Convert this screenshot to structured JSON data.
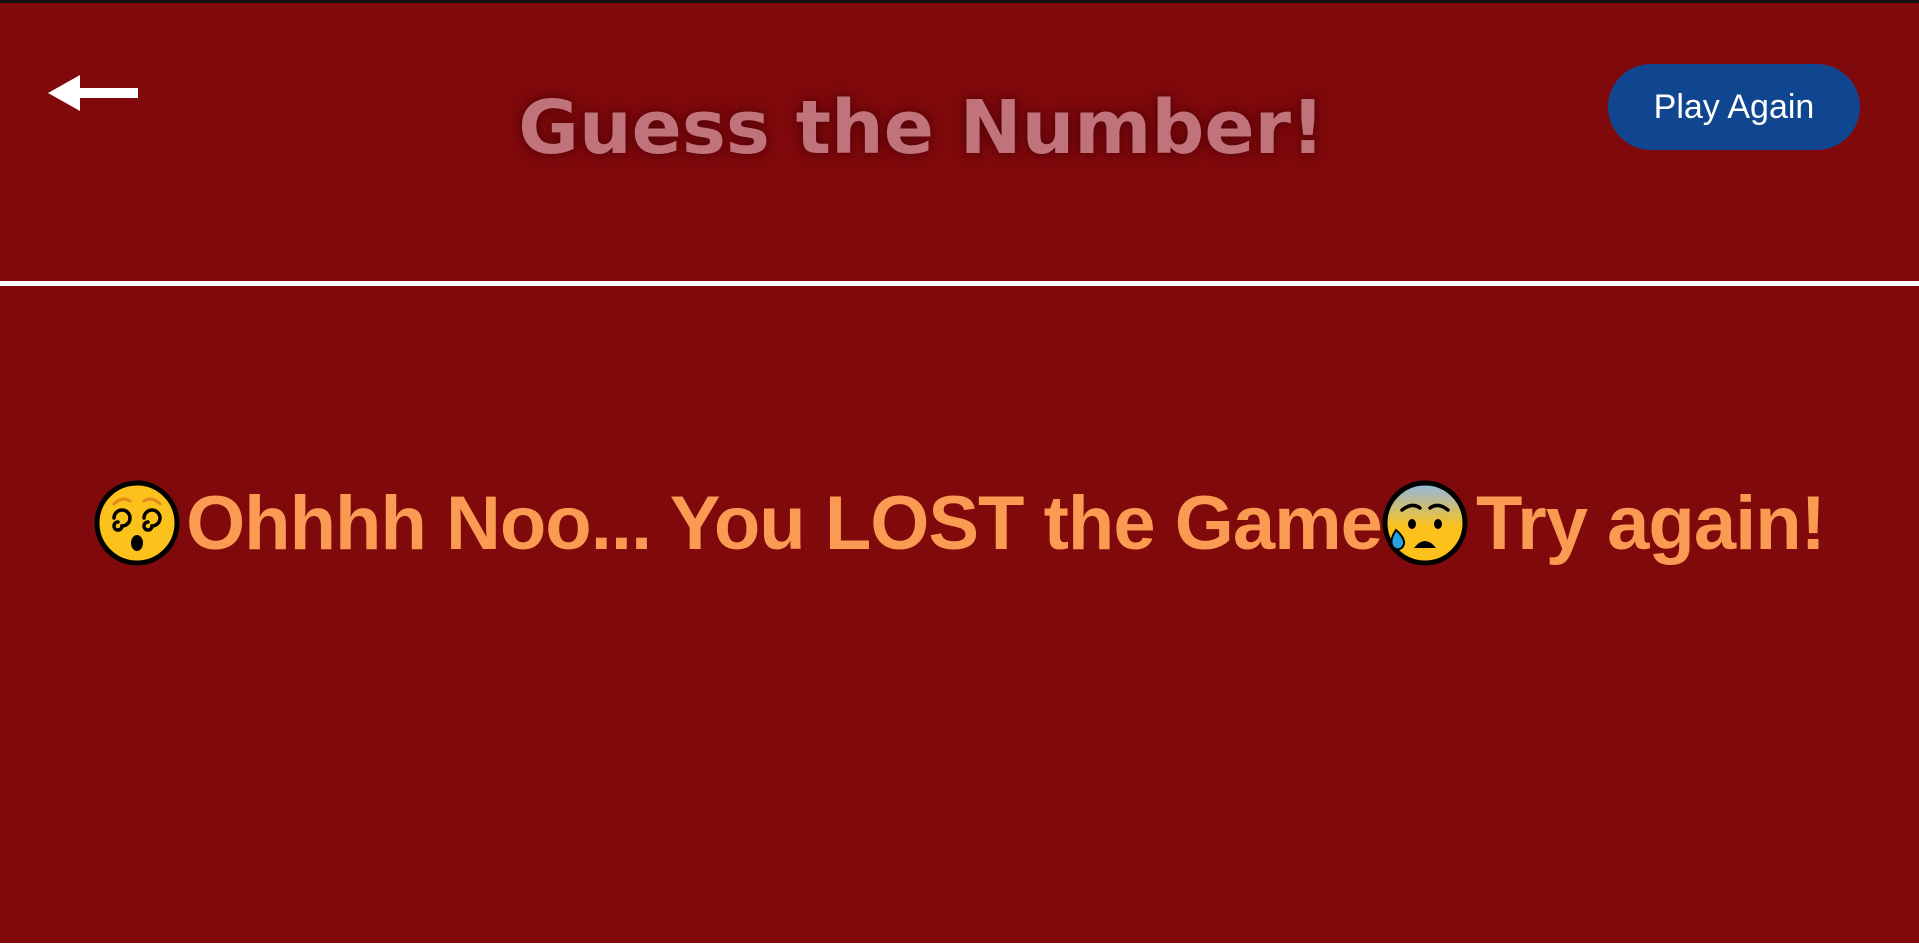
{
  "header": {
    "title": "Guess the Number!",
    "back_icon": "arrow-left-icon",
    "play_again_label": "Play Again"
  },
  "result": {
    "leading_emoji": "dizzy-face-icon",
    "message": "Ohhhh Noo... You LOST the Game",
    "trailing_emoji": "anxious-face-with-sweat-icon",
    "suffix": "Try again!"
  },
  "colors": {
    "background": "#7f090b",
    "title": "#c0737a",
    "message": "#fb9a52",
    "button": "#10468f",
    "divider": "#ffffff"
  }
}
